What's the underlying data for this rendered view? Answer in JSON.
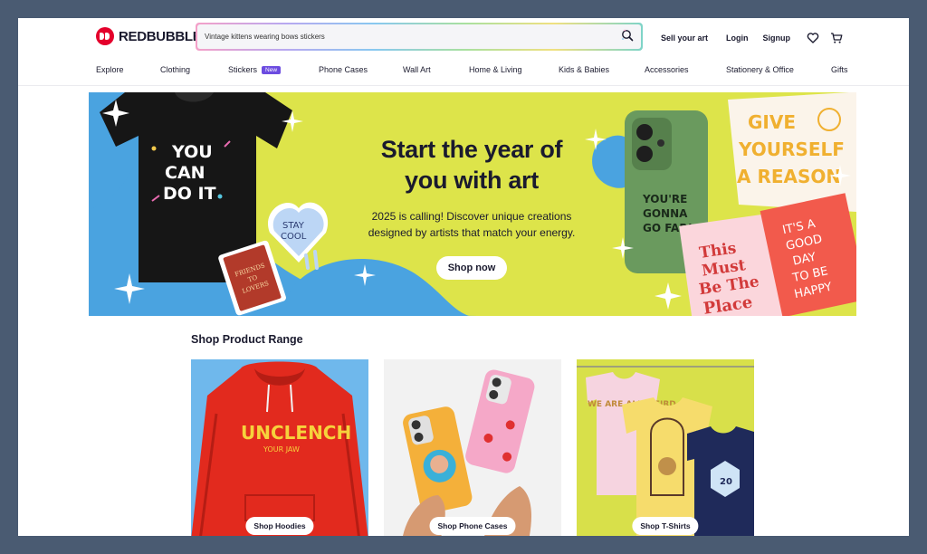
{
  "brand": {
    "name": "REDBUBBLE",
    "color": "#e4002b"
  },
  "search": {
    "value": "Vintage kittens wearing bows stickers"
  },
  "header_links": {
    "sell": "Sell your art",
    "login": "Login",
    "signup": "Signup"
  },
  "nav": {
    "explore": "Explore",
    "clothing": "Clothing",
    "stickers": "Stickers",
    "stickers_badge": "New",
    "phone_cases": "Phone Cases",
    "wall_art": "Wall Art",
    "home_living": "Home & Living",
    "kids_babies": "Kids & Babies",
    "accessories": "Accessories",
    "stationery": "Stationery & Office",
    "gifts": "Gifts"
  },
  "hero": {
    "title_line1": "Start the year of",
    "title_line2": "you with art",
    "subtitle_line1": "2025 is calling! Discover unique creations",
    "subtitle_line2": "designed by artists that match your energy.",
    "cta": "Shop now",
    "tshirt_text": [
      "YOU",
      "CAN",
      "DO IT"
    ],
    "sticker_text": [
      "STAY",
      "COOL"
    ],
    "book_text": [
      "FRIENDS",
      "TO",
      "LOVERS"
    ],
    "phone_text": [
      "YOU'RE",
      "GONNA",
      "GO FAR!"
    ],
    "pillow_text": [
      "GIVE",
      "YOURSELF",
      "A REASON"
    ],
    "card1_text": [
      "This",
      "Must",
      "Be The",
      "Place"
    ],
    "card2_text": [
      "IT'S A",
      "GOOD",
      "DAY",
      "TO BE",
      "HAPPY"
    ]
  },
  "range": {
    "title": "Shop Product Range",
    "cards": [
      {
        "label": "Shop Hoodies",
        "print_text": "UNCLENCH",
        "print_sub": "YOUR JAW"
      },
      {
        "label": "Shop Phone Cases"
      },
      {
        "label": "Shop T-Shirts",
        "print_text": "WE ARE ALL WEIRD",
        "dice": "20"
      }
    ]
  },
  "colors": {
    "hero_blue": "#4aa3e0",
    "hero_yellow": "#dde44a",
    "badge": "#6c4ce0"
  }
}
